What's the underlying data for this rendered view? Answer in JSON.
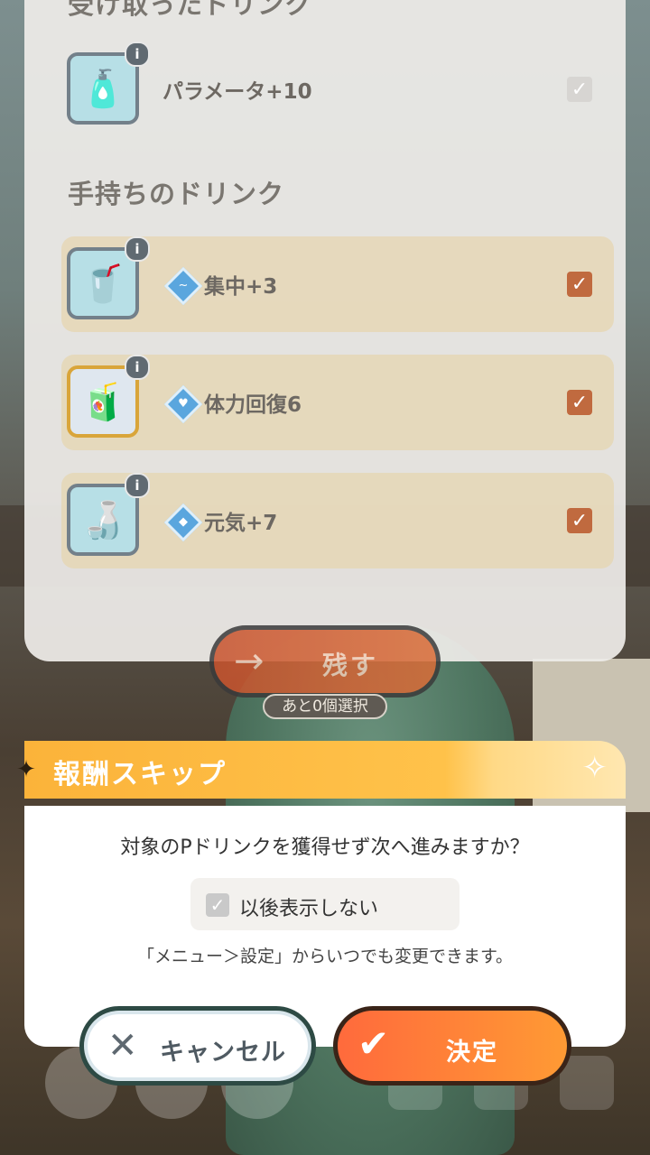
{
  "upper": {
    "received_title": "受け取ったドリンク",
    "received_item": {
      "label": "パラメータ+10",
      "icon": "water-bottle-icon"
    },
    "owned_title": "手持ちのドリンク",
    "owned_items": [
      {
        "label": "集中+3",
        "icon": "iced-coffee-icon",
        "effect_icon": "focus-icon",
        "checked": true
      },
      {
        "label": "体力回復6",
        "icon": "energy-drink-icon",
        "effect_icon": "heart-icon",
        "checked": true
      },
      {
        "label": "元気+7",
        "icon": "oolong-tea-icon",
        "effect_icon": "energy-icon",
        "checked": true
      }
    ],
    "leave_label": "残す",
    "remaining": "あと0個選択"
  },
  "dialog": {
    "title": "報酬スキップ",
    "message": "対象のPドリンクを獲得せず次へ進みますか？",
    "dont_show_label": "以後表示しない",
    "note": "「メニュー＞設定」からいつでも変更できます。",
    "cancel_label": "キャンセル",
    "ok_label": "決定"
  },
  "colors": {
    "accent": "#ff7a36",
    "header": "#fbb33a",
    "check_on": "#c06a3f"
  }
}
